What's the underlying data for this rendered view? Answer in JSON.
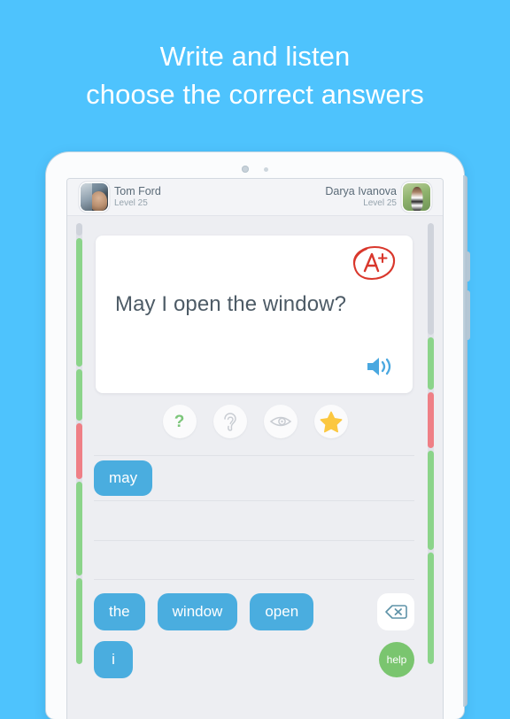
{
  "headline": {
    "line1": "Write and listen",
    "line2": "choose the correct answers"
  },
  "colors": {
    "background": "#4ec3fd",
    "chip_blue": "#4aaddf",
    "progress_green": "#8bd48a",
    "progress_red": "#ef7f86",
    "progress_empty": "#cfd3db",
    "help_green": "#7ac56f",
    "star_yellow": "#fbc740",
    "grade_red": "#d9372c",
    "speaker_blue": "#4aa8e0"
  },
  "players": {
    "left": {
      "name": "Tom Ford",
      "level": "Level 25",
      "avatar": "avatar-tom-ford"
    },
    "right": {
      "name": "Darya Ivanova",
      "level": "Level 25",
      "avatar": "avatar-darya-ivanova"
    }
  },
  "progress": {
    "left_rail": [
      {
        "state": "empty",
        "weight": 3
      },
      {
        "state": "green",
        "weight": 30
      },
      {
        "state": "green",
        "weight": 12
      },
      {
        "state": "red",
        "weight": 13
      },
      {
        "state": "green",
        "weight": 22
      },
      {
        "state": "green",
        "weight": 20
      }
    ],
    "right_rail": [
      {
        "state": "empty",
        "weight": 26
      },
      {
        "state": "green",
        "weight": 12
      },
      {
        "state": "red",
        "weight": 13
      },
      {
        "state": "green",
        "weight": 23
      },
      {
        "state": "green",
        "weight": 26
      }
    ]
  },
  "question_card": {
    "grade_badge": "A+",
    "grade_icon": "handwritten-a-plus-circle",
    "text": "May I open the window?",
    "speaker_icon": "speaker-sound-icon"
  },
  "helpers": [
    {
      "name": "hint-question-button",
      "icon": "question-mark-icon",
      "label": "?"
    },
    {
      "name": "listen-ear-button",
      "icon": "ear-icon",
      "label": ""
    },
    {
      "name": "reveal-eye-button",
      "icon": "eye-icon",
      "label": ""
    },
    {
      "name": "favorite-star-button",
      "icon": "star-icon",
      "label": ""
    }
  ],
  "answer": {
    "selected_words": [
      "may"
    ]
  },
  "word_bank": {
    "row1": [
      "the",
      "window",
      "open"
    ],
    "row2": [
      "i"
    ],
    "backspace_icon": "backspace-delete-icon",
    "help_label": "help"
  }
}
